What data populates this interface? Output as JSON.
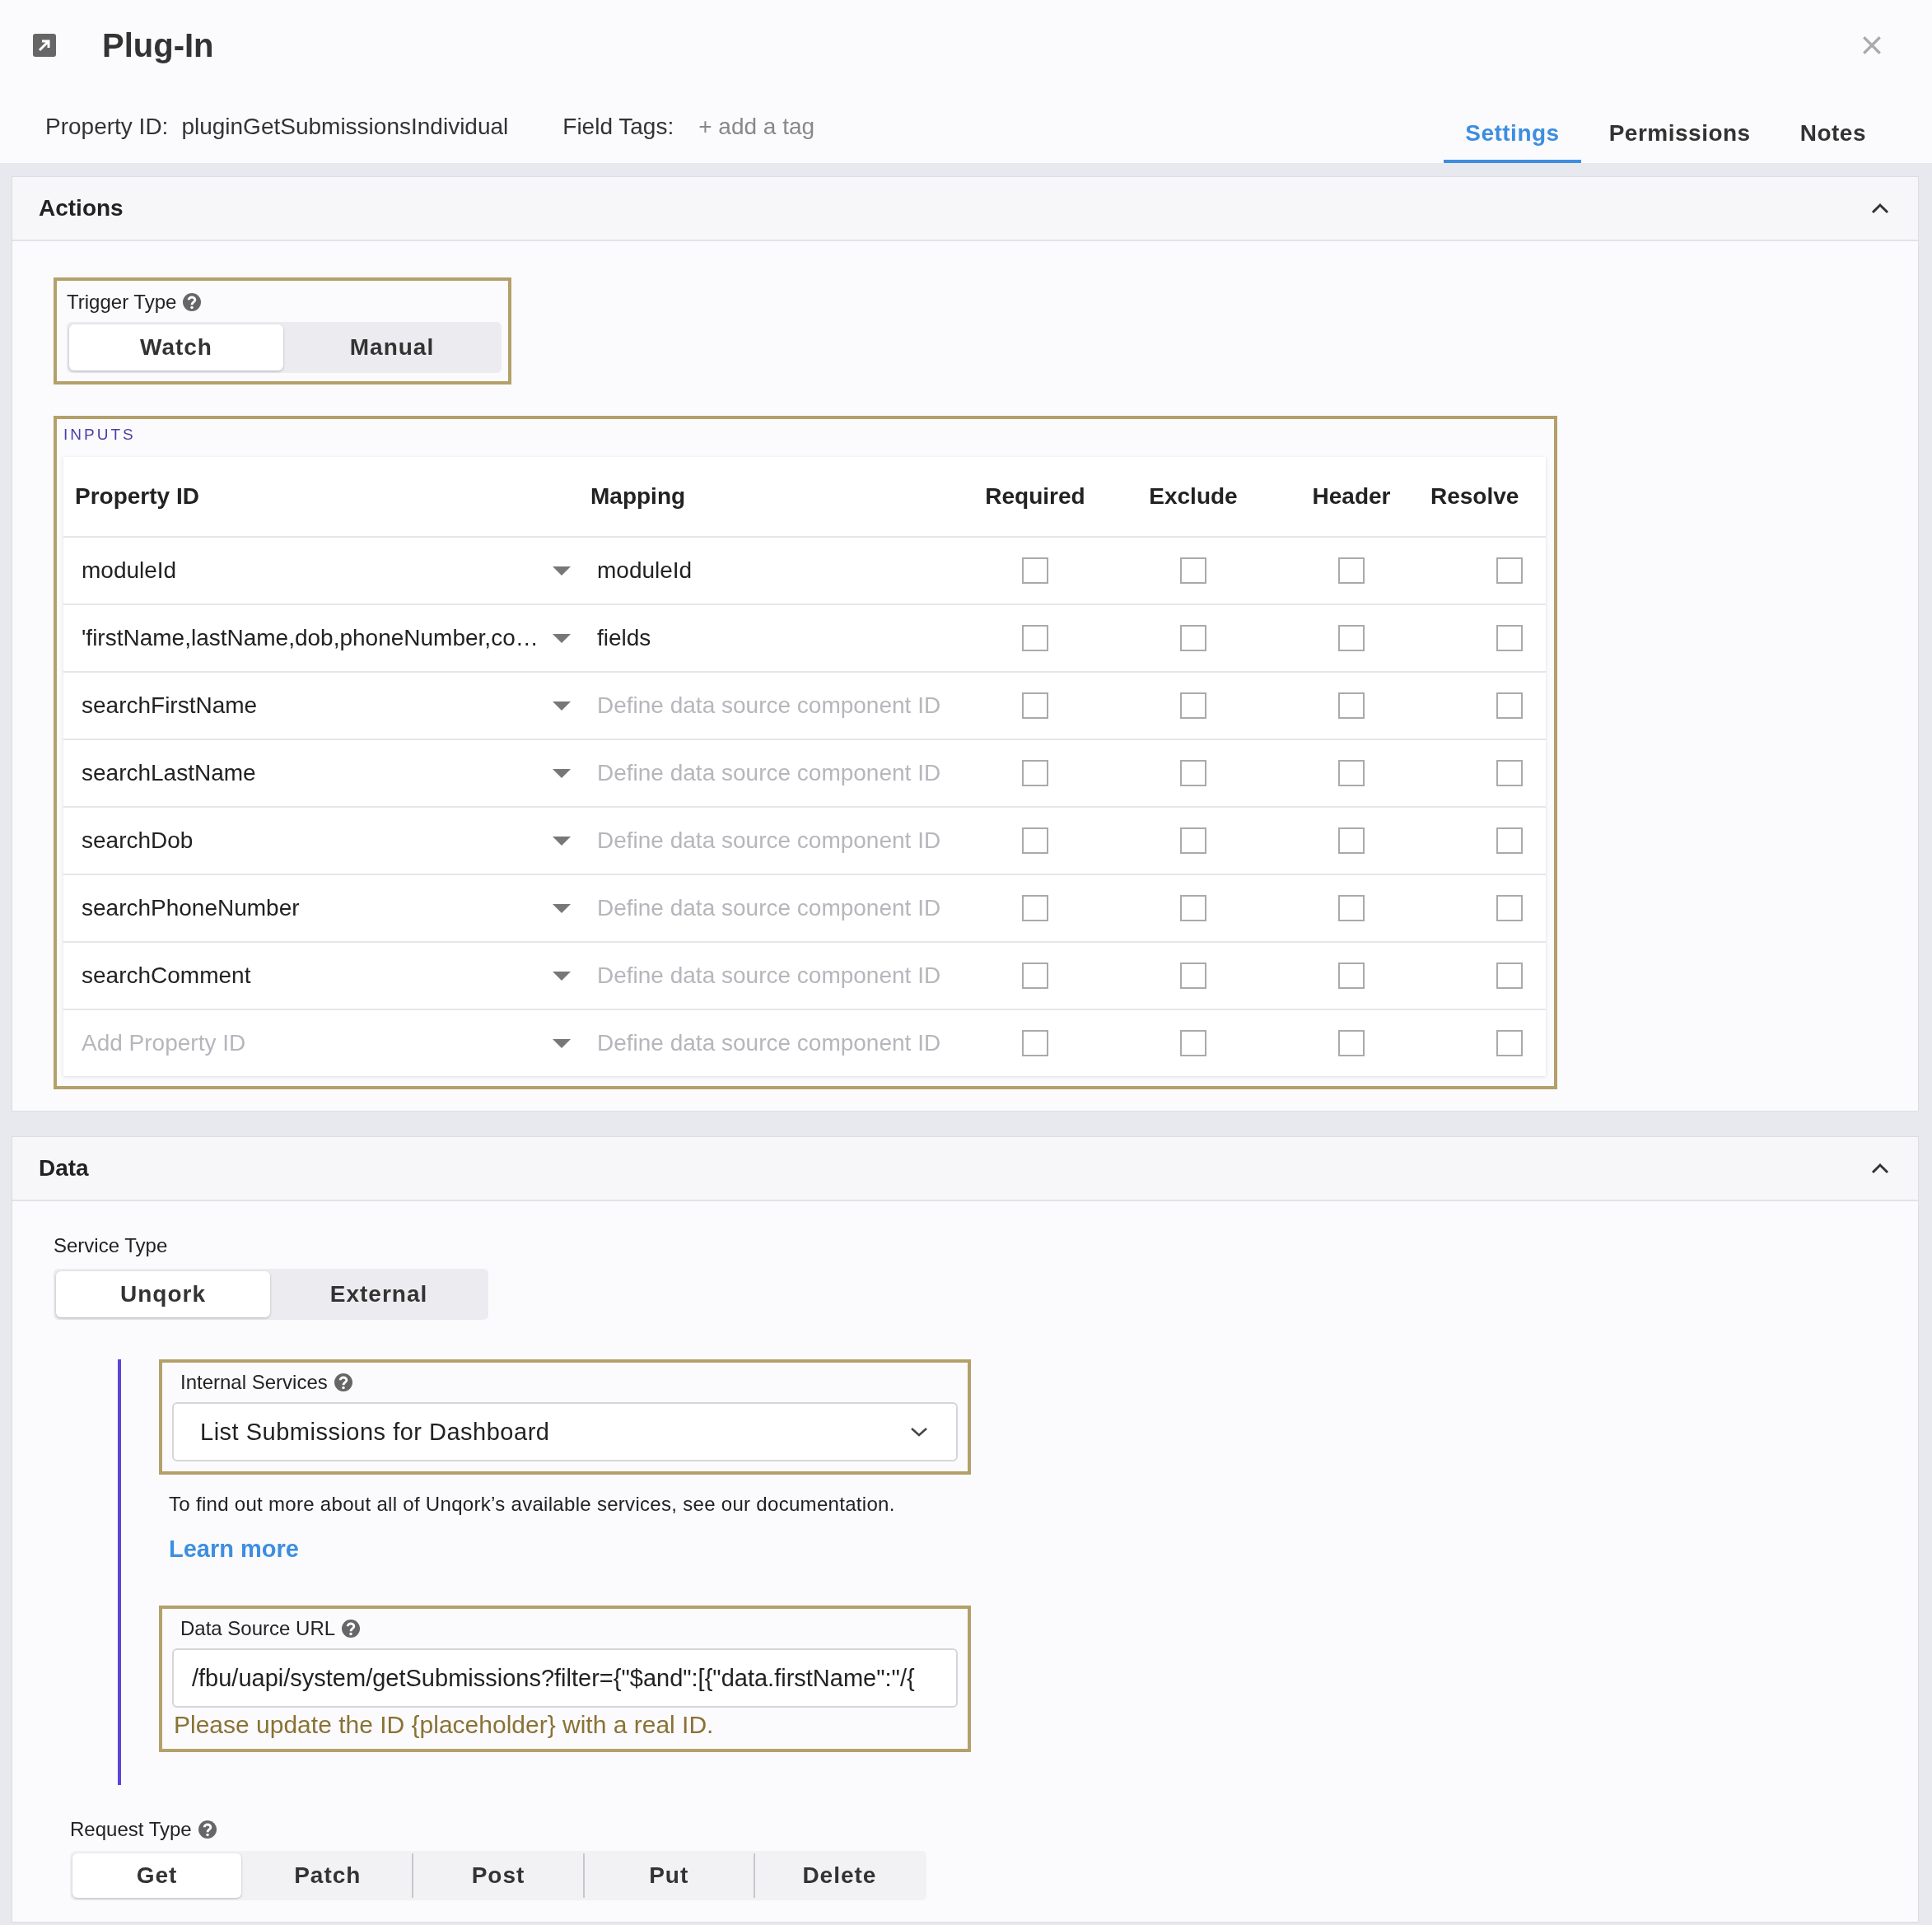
{
  "header": {
    "title": "Plug-In",
    "property_id_label": "Property ID:",
    "property_id": "pluginGetSubmissionsIndividual",
    "field_tags_label": "Field Tags:",
    "add_tag": "+ add a tag"
  },
  "tabs": [
    {
      "label": "Settings",
      "selected": true
    },
    {
      "label": "Permissions",
      "selected": false
    },
    {
      "label": "Notes",
      "selected": false
    }
  ],
  "actions": {
    "title": "Actions",
    "expanded": true,
    "trigger_type": {
      "label": "Trigger Type",
      "options": [
        {
          "label": "Watch",
          "selected": true
        },
        {
          "label": "Manual",
          "selected": false
        }
      ]
    },
    "inputs": {
      "title": "INPUTS",
      "columns": [
        "Property ID",
        "Mapping",
        "Required",
        "Exclude",
        "Header",
        "Resolve"
      ],
      "rows": [
        {
          "property_id": "moduleId",
          "mapping": "moduleId",
          "required": false,
          "exclude": false,
          "header": false,
          "resolve": false
        },
        {
          "property_id": "'firstName,lastName,dob,phoneNumber,co…",
          "mapping": "fields",
          "required": false,
          "exclude": false,
          "header": false,
          "resolve": false
        },
        {
          "property_id": "searchFirstName",
          "mapping_placeholder": "Define data source component ID",
          "required": false,
          "exclude": false,
          "header": false,
          "resolve": false
        },
        {
          "property_id": "searchLastName",
          "mapping_placeholder": "Define data source component ID",
          "required": false,
          "exclude": false,
          "header": false,
          "resolve": false
        },
        {
          "property_id": "searchDob",
          "mapping_placeholder": "Define data source component ID",
          "required": false,
          "exclude": false,
          "header": false,
          "resolve": false
        },
        {
          "property_id": "searchPhoneNumber",
          "mapping_placeholder": "Define data source component ID",
          "required": false,
          "exclude": false,
          "header": false,
          "resolve": false
        },
        {
          "property_id": "searchComment",
          "mapping_placeholder": "Define data source component ID",
          "required": false,
          "exclude": false,
          "header": false,
          "resolve": false
        },
        {
          "property_id_placeholder": "Add Property ID",
          "mapping_placeholder": "Define data source component ID",
          "required": false,
          "exclude": false,
          "header": false,
          "resolve": false
        }
      ]
    }
  },
  "data": {
    "title": "Data",
    "expanded": true,
    "service_type": {
      "label": "Service Type",
      "options": [
        {
          "label": "Unqork",
          "selected": true
        },
        {
          "label": "External",
          "selected": false
        }
      ]
    },
    "internal_services": {
      "label": "Internal Services",
      "value": "List Submissions for Dashboard"
    },
    "help_text": "To find out more about all of Unqork’s available services, see our documentation.",
    "learn_more": "Learn more",
    "data_source_url": {
      "label": "Data Source URL",
      "value": "/fbu/uapi/system/getSubmissions?filter={\"$and\":[{\"data.firstName\":\"/{",
      "warning": "Please update the ID {placeholder} with a real ID."
    },
    "request_type": {
      "label": "Request Type",
      "options": [
        {
          "label": "Get",
          "selected": true
        },
        {
          "label": "Patch",
          "selected": false
        },
        {
          "label": "Post",
          "selected": false
        },
        {
          "label": "Put",
          "selected": false
        },
        {
          "label": "Delete",
          "selected": false
        }
      ]
    }
  }
}
